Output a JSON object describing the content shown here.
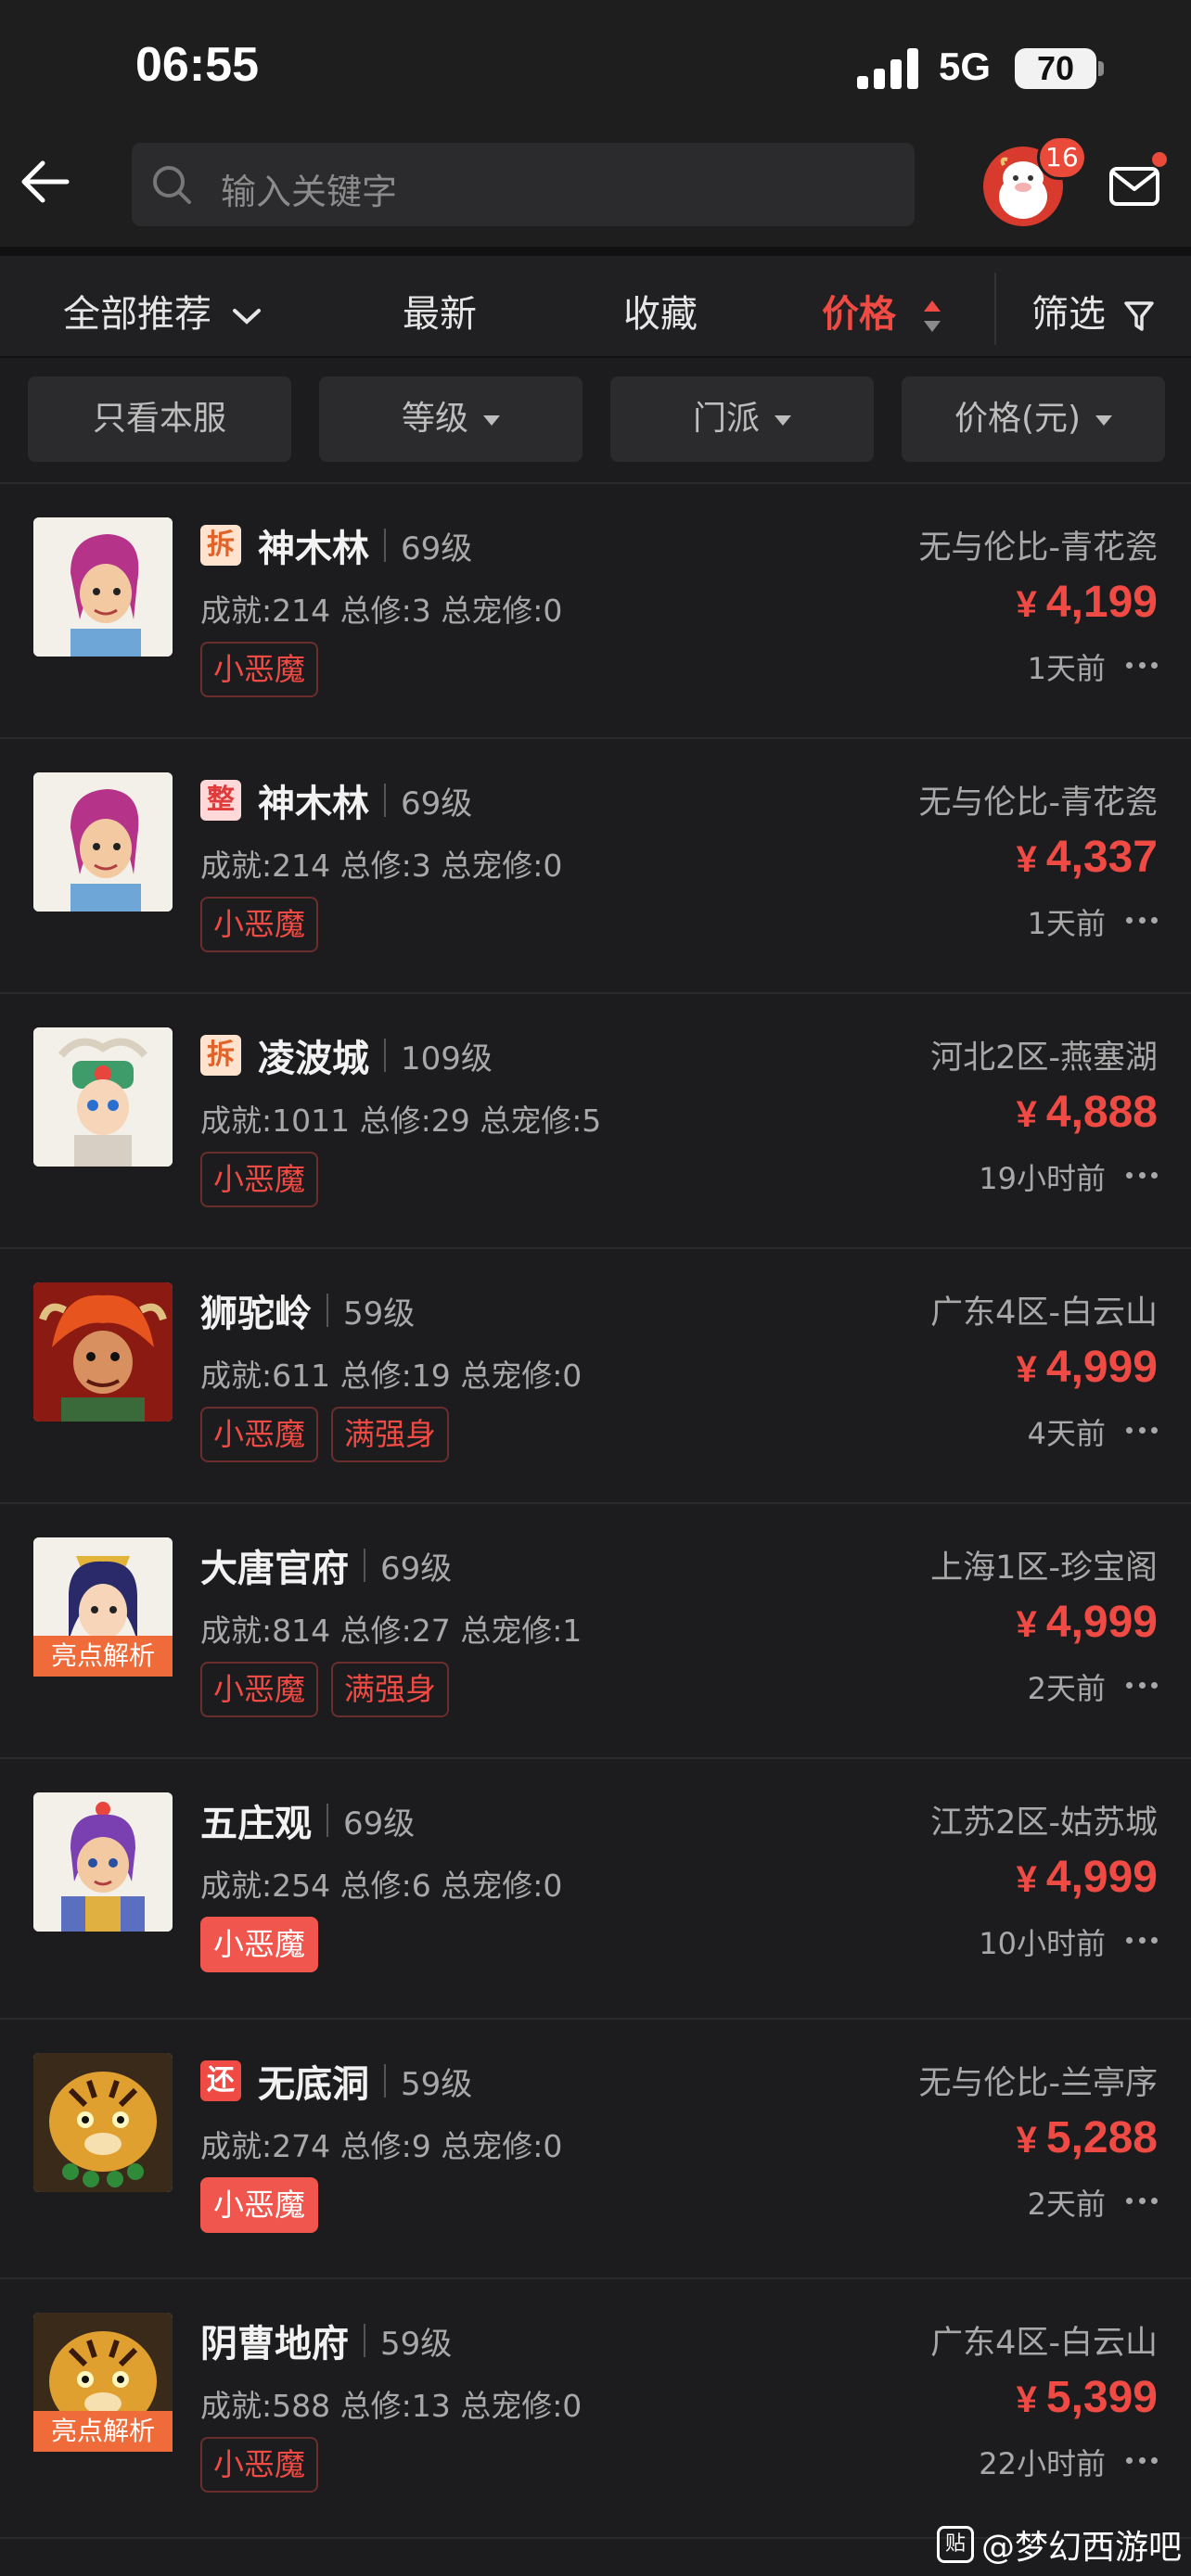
{
  "status_bar": {
    "time": "06:55",
    "network": "5G",
    "battery": "70"
  },
  "nav": {
    "search_placeholder": "输入关键字",
    "message_badge": "16"
  },
  "sort_tabs": [
    {
      "label": "全部推荐"
    },
    {
      "label": "最新"
    },
    {
      "label": "收藏"
    },
    {
      "label": "价格"
    },
    {
      "label": "筛选"
    }
  ],
  "active_sort": "价格",
  "filters": [
    {
      "label": "只看本服"
    },
    {
      "label": "等级"
    },
    {
      "label": "门派"
    },
    {
      "label": "价格(元)"
    }
  ],
  "colors": {
    "accent": "#ef4a43",
    "background": "#1c1c1e",
    "highlight_tag": "#f06b3a"
  },
  "listings": [
    {
      "tag": "拆",
      "school": "神木林",
      "level": "69级",
      "stats": "成就:214 总修:3 总宠修:0",
      "pills": [
        "小恶魔"
      ],
      "server": "无与伦比-青花瓷",
      "currency": "¥",
      "price": "4,199",
      "time": "1天前",
      "thumb_label": "",
      "avatar_icon": "shenmulin-avatar-icon"
    },
    {
      "tag": "整",
      "school": "神木林",
      "level": "69级",
      "stats": "成就:214 总修:3 总宠修:0",
      "pills": [
        "小恶魔"
      ],
      "server": "无与伦比-青花瓷",
      "currency": "¥",
      "price": "4,337",
      "time": "1天前",
      "thumb_label": "",
      "avatar_icon": "shenmulin-avatar-icon"
    },
    {
      "tag": "拆",
      "school": "凌波城",
      "level": "109级",
      "stats": "成就:1011 总修:29 总宠修:5",
      "pills": [
        "小恶魔"
      ],
      "server": "河北2区-燕塞湖",
      "currency": "¥",
      "price": "4,888",
      "time": "19小时前",
      "thumb_label": "",
      "avatar_icon": "lingbocheng-avatar-icon"
    },
    {
      "tag": "",
      "school": "狮驼岭",
      "level": "59级",
      "stats": "成就:611 总修:19 总宠修:0",
      "pills": [
        "小恶魔",
        "满强身"
      ],
      "server": "广东4区-白云山",
      "currency": "¥",
      "price": "4,999",
      "time": "4天前",
      "thumb_label": "",
      "avatar_icon": "shituoling-avatar-icon"
    },
    {
      "tag": "",
      "school": "大唐官府",
      "level": "69级",
      "stats": "成就:814 总修:27 总宠修:1",
      "pills": [
        "小恶魔",
        "满强身"
      ],
      "server": "上海1区-珍宝阁",
      "currency": "¥",
      "price": "4,999",
      "time": "2天前",
      "thumb_label": "亮点解析",
      "avatar_icon": "datang-avatar-icon"
    },
    {
      "tag": "",
      "school": "五庄观",
      "level": "69级",
      "stats": "成就:254 总修:6 总宠修:0",
      "pills": [
        "小恶魔"
      ],
      "pill_filled": true,
      "server": "江苏2区-姑苏城",
      "currency": "¥",
      "price": "4,999",
      "time": "10小时前",
      "thumb_label": "",
      "avatar_icon": "wuzhuangguan-avatar-icon"
    },
    {
      "tag": "还",
      "school": "无底洞",
      "level": "59级",
      "stats": "成就:274 总修:9 总宠修:0",
      "pills": [
        "小恶魔"
      ],
      "pill_filled": true,
      "server": "无与伦比-兰亭序",
      "currency": "¥",
      "price": "5,288",
      "time": "2天前",
      "thumb_label": "",
      "avatar_icon": "tiger-avatar-icon"
    },
    {
      "tag": "",
      "school": "阴曹地府",
      "level": "59级",
      "stats": "成就:588 总修:13 总宠修:0",
      "pills": [
        "小恶魔"
      ],
      "server": "广东4区-白云山",
      "currency": "¥",
      "price": "5,399",
      "time": "22小时前",
      "thumb_label": "亮点解析",
      "avatar_icon": "tiger-avatar-icon"
    }
  ],
  "watermark": {
    "icon": "贴",
    "text": "@梦幻西游吧"
  }
}
